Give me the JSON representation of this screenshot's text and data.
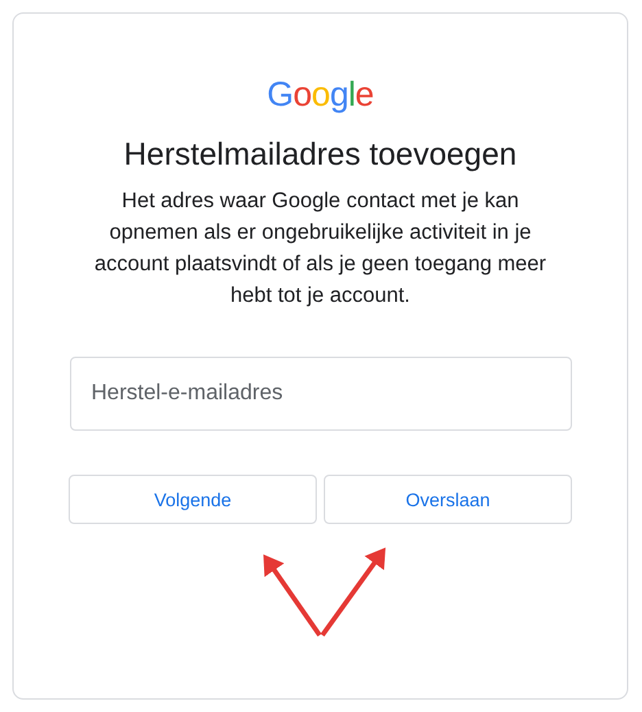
{
  "logo": {
    "text": "Google"
  },
  "title": "Herstelmailadres toevoegen",
  "description": "Het adres waar Google contact met je kan opnemen als er ongebruikelijke activiteit in je account plaatsvindt of als je geen toegang meer hebt tot je account.",
  "email_field": {
    "placeholder": "Herstel-e-mailadres"
  },
  "buttons": [
    {
      "label": "Volgende"
    },
    {
      "label": "Overslaan"
    }
  ]
}
